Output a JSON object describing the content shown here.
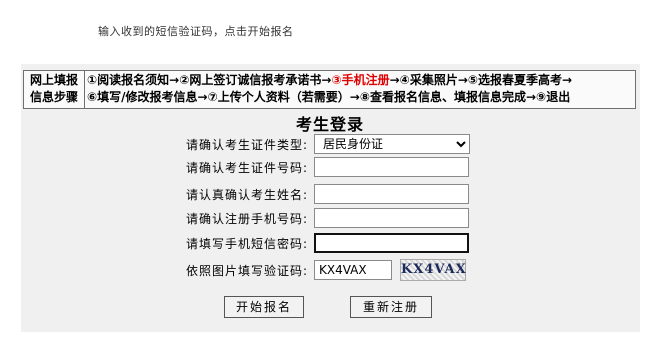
{
  "instruction": "输入收到的短信验证码，点击开始报名",
  "steps": {
    "label_line1": "网上填报",
    "label_line2": "信息步骤",
    "line1_a": "①阅读报名须知→②网上签订诚信报考承诺书→",
    "line1_current": "③手机注册",
    "line1_b": "→④采集照片→⑤选报春夏季高考→",
    "line2": "⑥填写/修改报考信息→⑦上传个人资料（若需要）→⑧查看报名信息、填报信息完成→⑨退出"
  },
  "form": {
    "title": "考生登录",
    "id_type": {
      "label": "请确认考生证件类型:",
      "value": "居民身份证"
    },
    "id_number": {
      "label": "请确认考生证件号码:",
      "value": ""
    },
    "name": {
      "label": "请认真确认考生姓名:",
      "value": ""
    },
    "phone": {
      "label": "请确认注册手机号码:",
      "value": ""
    },
    "sms": {
      "label": "请填写手机短信密码:",
      "value": ""
    },
    "captcha": {
      "label": "依照图片填写验证码:",
      "value": "KX4VAX",
      "image_text": "KX4VAX"
    }
  },
  "buttons": {
    "start": "开始报名",
    "reregister": "重新注册"
  }
}
